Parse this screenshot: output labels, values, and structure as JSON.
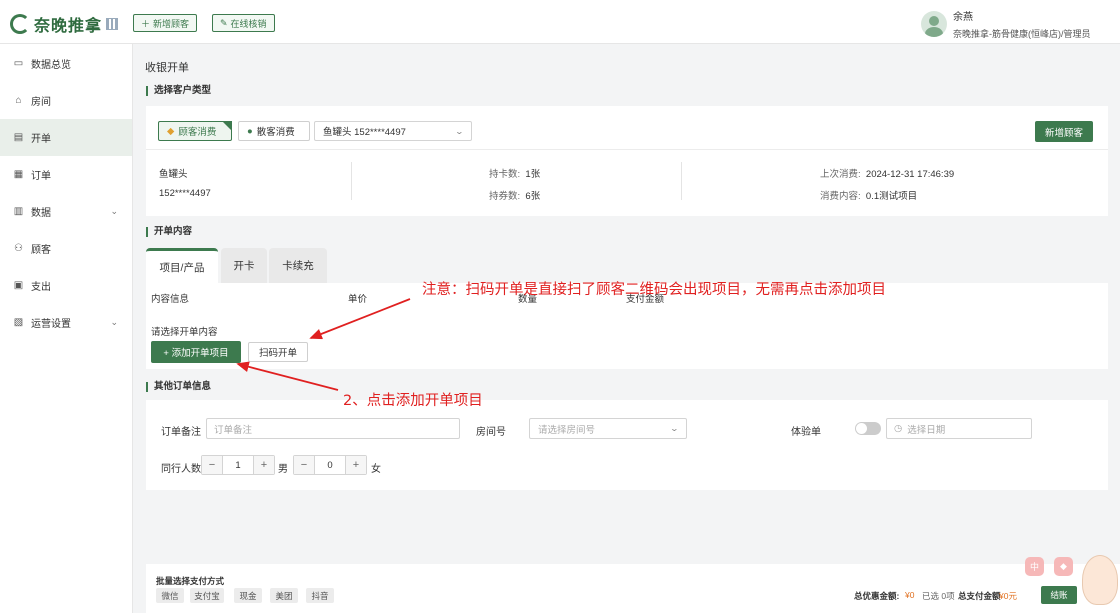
{
  "header": {
    "logo_text": "奈晚推拿",
    "new_customer_btn": "新增顾客",
    "online_verify_btn": "在线核销",
    "user_name": "余燕",
    "user_role": "奈晚推拿-筋骨健康(恒峰店)/管理员"
  },
  "sidebar": {
    "items": [
      {
        "label": "数据总览",
        "icon": "monitor-icon"
      },
      {
        "label": "房间",
        "icon": "home-icon"
      },
      {
        "label": "开单",
        "icon": "document-icon"
      },
      {
        "label": "订单",
        "icon": "order-icon"
      },
      {
        "label": "数据",
        "icon": "chart-icon"
      },
      {
        "label": "顾客",
        "icon": "user-icon"
      },
      {
        "label": "支出",
        "icon": "wallet-icon"
      },
      {
        "label": "运营设置",
        "icon": "settings-icon"
      }
    ],
    "active_index": 2
  },
  "page": {
    "title": "收银开单"
  },
  "customer_section": {
    "title": "选择客户类型",
    "member_label": "顾客消费",
    "walkin_label": "散客消费",
    "customer_select": "鱼罐头 152****4497",
    "add_customer_btn": "新增顾客",
    "name": "鱼罐头",
    "phone": "152****4497",
    "card_count_label": "持卡数:",
    "card_count_value": "1张",
    "coupon_count_label": "持券数:",
    "coupon_count_value": "6张",
    "last_visit_label": "上次消费:",
    "last_visit_value": "2024-12-31 17:46:39",
    "last_item_label": "消费内容:",
    "last_item_value": "0.1测试项目"
  },
  "order_section": {
    "title": "开单内容",
    "tabs": [
      "项目/产品",
      "开卡",
      "卡续充"
    ],
    "active_tab": 0,
    "columns": [
      "内容信息",
      "单价",
      "数量",
      "支付金额"
    ],
    "select_prompt": "请选择开单内容",
    "add_item_btn": "+ 添加开单项目",
    "scan_btn": "扫码开单"
  },
  "annotations": {
    "note": "注意：扫码开单是直接扫了顾客二维码会出现项目，无需再点击添加项目",
    "step2": "2、点击添加开单项目"
  },
  "other_section": {
    "title": "其他订单信息",
    "remark_label": "订单备注",
    "remark_placeholder": "订单备注",
    "room_label": "房间号",
    "room_placeholder": "请选择房间号",
    "trial_label": "体验单",
    "date_placeholder": "选择日期",
    "companions_label": "同行人数",
    "male_count": "1",
    "male_label": "男",
    "female_count": "0",
    "female_label": "女"
  },
  "footer": {
    "batch_pay_label": "批量选择支付方式",
    "pay_methods": [
      "微信",
      "支付宝",
      "现金",
      "美团",
      "抖音"
    ],
    "discount_label": "总优惠金额:",
    "discount_value": "¥0",
    "selected_label": "已选 0项",
    "total_label": "总支付金额",
    "total_value": "¥0元",
    "checkout_btn": "结账"
  },
  "colors": {
    "brand_green": "#3d7a4e",
    "annotation_red": "#e02020",
    "accent_orange": "#e07020"
  }
}
